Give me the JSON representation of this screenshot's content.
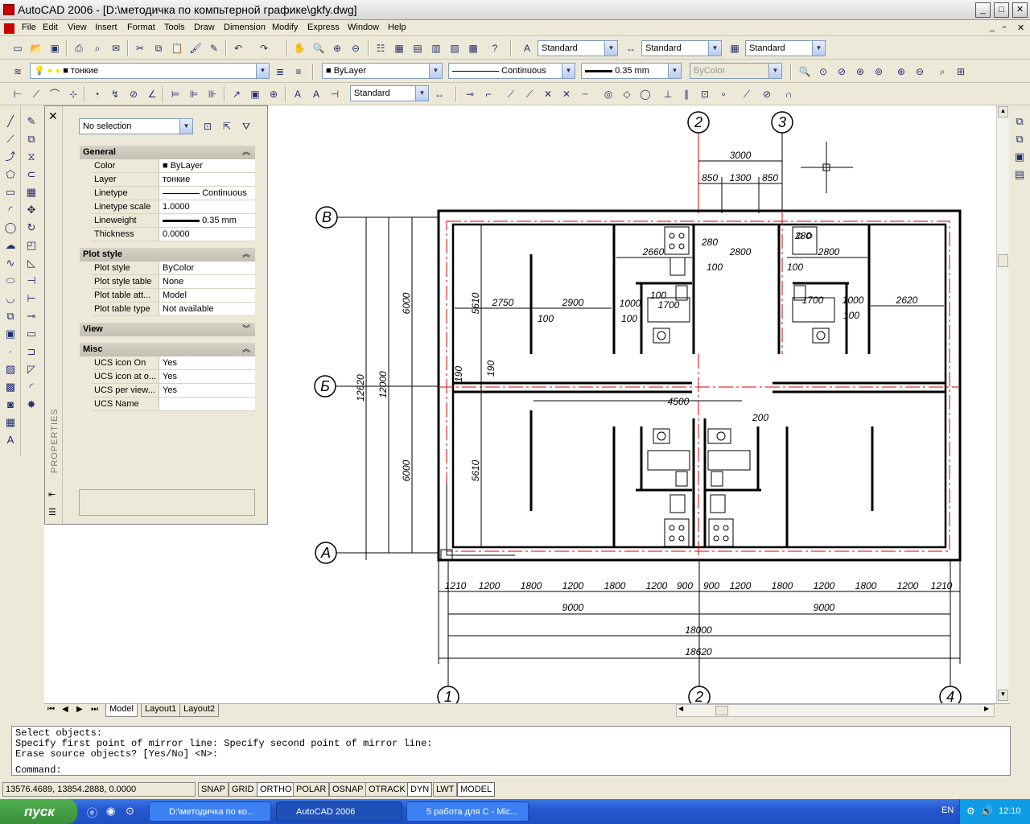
{
  "window": {
    "title": "AutoCAD 2006 - [D:\\методичка по компьтерной графике\\gkfy.dwg]",
    "min": "_",
    "max": "□",
    "close": "✕"
  },
  "menu": [
    "File",
    "Edit",
    "View",
    "Insert",
    "Format",
    "Tools",
    "Draw",
    "Dimension",
    "Modify",
    "Express",
    "Window",
    "Help"
  ],
  "toolbar": {
    "text_style": "Standard",
    "dim_style": "Standard",
    "table_style": "Standard",
    "layer": "тонкие",
    "color": "ByLayer",
    "linetype": "Continuous",
    "lineweight": "0.35 mm",
    "plotstyle": "ByColor",
    "dim_style2": "Standard"
  },
  "properties": {
    "selection": "No selection",
    "side_label": "PROPERTIES",
    "sections": {
      "general": "General",
      "plot": "Plot style",
      "view": "View",
      "misc": "Misc"
    },
    "general": [
      {
        "k": "Color",
        "v": "ByLayer"
      },
      {
        "k": "Layer",
        "v": "тонкие"
      },
      {
        "k": "Linetype",
        "v": "Continuous"
      },
      {
        "k": "Linetype scale",
        "v": "1.0000"
      },
      {
        "k": "Lineweight",
        "v": "0.35 mm"
      },
      {
        "k": "Thickness",
        "v": "0.0000"
      }
    ],
    "plot": [
      {
        "k": "Plot style",
        "v": "ByColor"
      },
      {
        "k": "Plot style table",
        "v": "None"
      },
      {
        "k": "Plot table att...",
        "v": "Model"
      },
      {
        "k": "Plot table type",
        "v": "Not available"
      }
    ],
    "misc": [
      {
        "k": "UCS icon On",
        "v": "Yes"
      },
      {
        "k": "UCS icon at o...",
        "v": "Yes"
      },
      {
        "k": "UCS per view...",
        "v": "Yes"
      },
      {
        "k": "UCS Name",
        "v": ""
      }
    ]
  },
  "drawing": {
    "axes_top": [
      "2",
      "3"
    ],
    "axes_left": [
      "В",
      "Б",
      "А"
    ],
    "axes_bottom": [
      "1",
      "2",
      "4"
    ],
    "dims_top": [
      "3000",
      "850",
      "1300",
      "850"
    ],
    "dims_left": [
      "12620",
      "12000",
      "6000",
      "6000",
      "5610",
      "5610",
      "190",
      "190"
    ],
    "dims_inner": [
      "2660",
      "280",
      "2800",
      "2800",
      "280",
      "100",
      "100",
      "2750",
      "2900",
      "1000",
      "1700",
      "100",
      "100",
      "1700",
      "1000",
      "2620",
      "100",
      "100",
      "4500",
      "200"
    ],
    "dims_bottom_row": [
      "1210",
      "1200",
      "1800",
      "1200",
      "1800",
      "1200",
      "900",
      "900",
      "1200",
      "1800",
      "1200",
      "1800",
      "1200",
      "1210"
    ],
    "dims_bottom": [
      "9000",
      "9000",
      "18000",
      "18620"
    ]
  },
  "layout_tabs": [
    "Model",
    "Layout1",
    "Layout2"
  ],
  "command": {
    "lines": [
      "Select objects:",
      "Specify first point of mirror line: Specify second point of mirror line:",
      "Erase source objects? [Yes/No] <N>:"
    ],
    "prompt": "Command:"
  },
  "status": {
    "coords": "13576.4689, 13854.2888, 0.0000",
    "buttons": [
      "SNAP",
      "GRID",
      "ORTHO",
      "POLAR",
      "OSNAP",
      "OTRACK",
      "DYN",
      "LWT",
      "MODEL"
    ]
  },
  "taskbar": {
    "start": "пуск",
    "tasks": [
      "D:\\методичка по ко...",
      "AutoCAD 2006",
      "5 работа для С - Mic..."
    ],
    "lang": "EN",
    "time": "12:10"
  }
}
